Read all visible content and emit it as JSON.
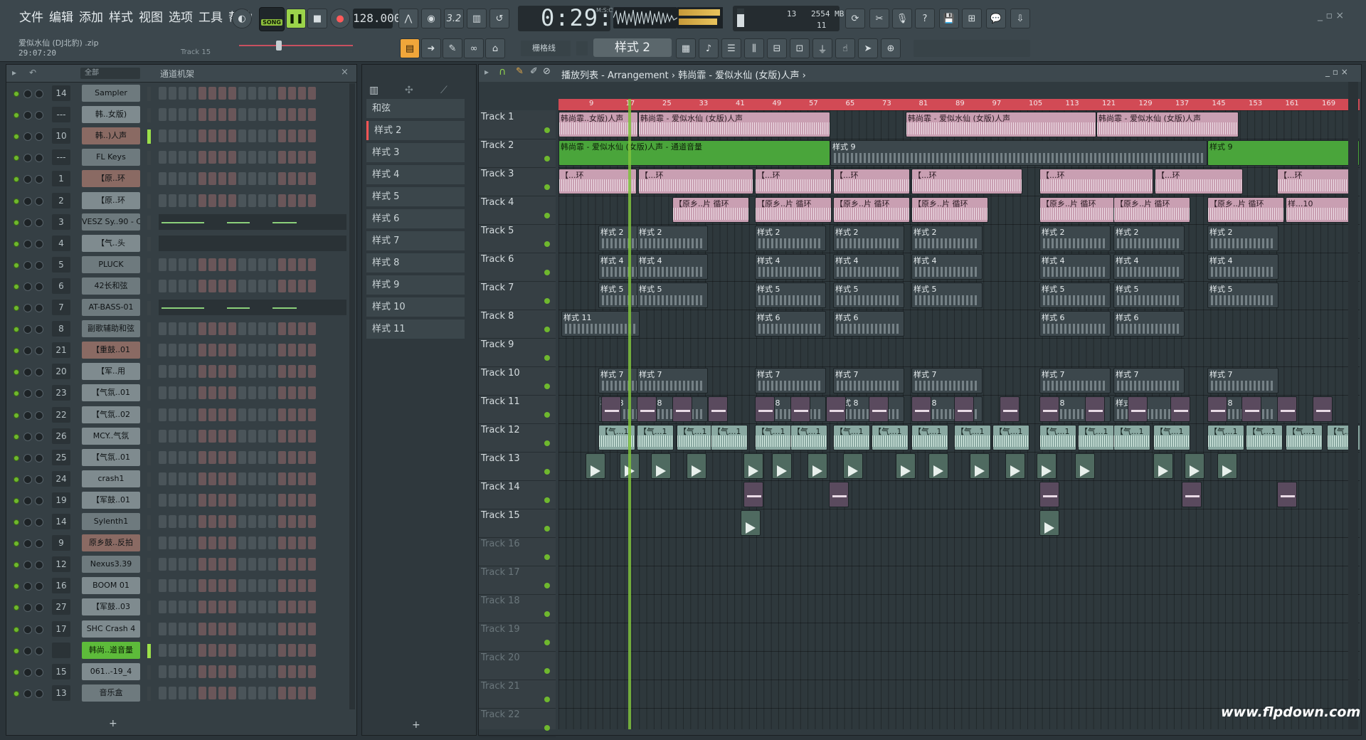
{
  "menu": [
    "文件",
    "编辑",
    "添加",
    "样式",
    "视图",
    "选项",
    "工具",
    "帮助"
  ],
  "song": {
    "file": "爱似水仙 (DJ北豹) .zip",
    "time": "29:07:20",
    "track_hint": "Track 15"
  },
  "transport": {
    "mode": "SONG",
    "tempo": "128.000",
    "clock": "0:29:40",
    "clock_unit": "M:S:CS"
  },
  "cpu": {
    "voices": "13",
    "memory": "2554 MB",
    "polyphony": "11"
  },
  "toolbar": {
    "pattern": "样式 2",
    "snap": "栅格线"
  },
  "rack": {
    "filter": "全部",
    "title": "通道机架",
    "add": "+",
    "channels": [
      {
        "num": "14",
        "name": "Sampler",
        "style": "dark"
      },
      {
        "num": "---",
        "name": "韩..女版)",
        "style": "normal"
      },
      {
        "num": "10",
        "name": "韩..)人声",
        "style": "red"
      },
      {
        "num": "---",
        "name": "FL Keys",
        "style": "dark"
      },
      {
        "num": "1",
        "name": "【原..环",
        "style": "red"
      },
      {
        "num": "2",
        "name": "【原..环",
        "style": "normal"
      },
      {
        "num": "3",
        "name": "VESZ Sy..90 - C",
        "style": "dark",
        "roll": true
      },
      {
        "num": "4",
        "name": "【气..头",
        "style": "normal",
        "roll": true
      },
      {
        "num": "5",
        "name": "PLUCK",
        "style": "dark"
      },
      {
        "num": "6",
        "name": "42长和弦",
        "style": "dark"
      },
      {
        "num": "7",
        "name": "AT-BASS-01",
        "style": "dark",
        "roll": true
      },
      {
        "num": "8",
        "name": "副歌辅助和弦",
        "style": "dark"
      },
      {
        "num": "21",
        "name": "【重鼓..01",
        "style": "red"
      },
      {
        "num": "20",
        "name": "【军..用",
        "style": "normal"
      },
      {
        "num": "23",
        "name": "【气氛..01",
        "style": "normal"
      },
      {
        "num": "22",
        "name": "【气氛..02",
        "style": "normal"
      },
      {
        "num": "26",
        "name": "MCY..气氛",
        "style": "normal"
      },
      {
        "num": "25",
        "name": "【气氛..01",
        "style": "normal"
      },
      {
        "num": "24",
        "name": "crash1",
        "style": "normal"
      },
      {
        "num": "19",
        "name": "【军鼓..01",
        "style": "normal"
      },
      {
        "num": "14",
        "name": "Sylenth1",
        "style": "dark"
      },
      {
        "num": "9",
        "name": "原乡鼓..反拍",
        "style": "red"
      },
      {
        "num": "12",
        "name": "Nexus3.39",
        "style": "dark"
      },
      {
        "num": "16",
        "name": "BOOM 01",
        "style": "normal"
      },
      {
        "num": "27",
        "name": "【军鼓..03",
        "style": "normal"
      },
      {
        "num": "17",
        "name": "SHC Crash 4",
        "style": "normal"
      },
      {
        "num": "",
        "name": "韩尚..道音量",
        "style": "green"
      },
      {
        "num": "15",
        "name": "061..-19_4",
        "style": "normal"
      },
      {
        "num": "13",
        "name": "音乐盒",
        "style": "dark"
      }
    ]
  },
  "picker": {
    "items": [
      "和弦",
      "样式 2",
      "样式 3",
      "样式 4",
      "样式 5",
      "样式 6",
      "样式 7",
      "样式 8",
      "样式 9",
      "样式 10",
      "样式 11"
    ],
    "add": "+"
  },
  "playlist": {
    "title": "播放列表 - Arrangement › 韩尚霏 - 爱似水仙 (女版)人声 ›",
    "bars": [
      "9",
      "17",
      "25",
      "33",
      "41",
      "49",
      "57",
      "65",
      "73",
      "81",
      "89",
      "97",
      "105",
      "113",
      "121",
      "129",
      "137",
      "145",
      "153",
      "161",
      "169"
    ],
    "tracks": [
      "Track 1",
      "Track 2",
      "Track 3",
      "Track 4",
      "Track 5",
      "Track 6",
      "Track 7",
      "Track 8",
      "Track 9",
      "Track 10",
      "Track 11",
      "Track 12",
      "Track 13",
      "Track 14",
      "Track 15",
      "Track 16",
      "Track 17",
      "Track 18",
      "Track 19",
      "Track 20",
      "Track 21",
      "Track 22"
    ],
    "clip_labels": {
      "vocal": "韩尚霏 - 爱似水仙 (女版)人声",
      "vocal_short": "韩尚霏..女版)人声",
      "vocal_volume": "韩尚霏 - 爱似水仙 (女版)人声 - 通道音量",
      "loop": "【原乡..片 循环",
      "loop_short": "【...环",
      "atmos": "【气...1",
      "p2": "样式 2",
      "p4": "样式 4",
      "p5": "样式 5",
      "p6": "样式 6",
      "p7": "样式 7",
      "p8": "样式 8",
      "p9": "样式 9",
      "p10": "样...10",
      "p11": "样式 11"
    }
  },
  "watermark": "www.flpdown.com"
}
